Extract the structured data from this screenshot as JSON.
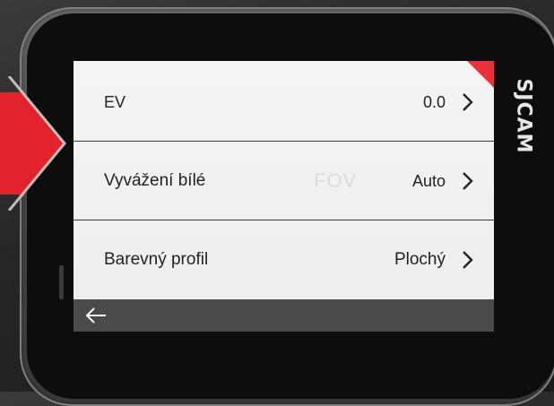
{
  "device": {
    "brand_logo": "SJCAM"
  },
  "menu": {
    "items": [
      {
        "label": "EV",
        "value": "0.0"
      },
      {
        "label": "Vyvážení bílé",
        "value": "Auto"
      },
      {
        "label": "Barevný profil",
        "value": "Plochý"
      }
    ],
    "ghost_text": "FOV"
  },
  "colors": {
    "accent": "#e8323a",
    "bar": "#4a4a4a"
  },
  "icons": {
    "back": "arrow-left-icon",
    "chevron": "chevron-right-icon"
  }
}
